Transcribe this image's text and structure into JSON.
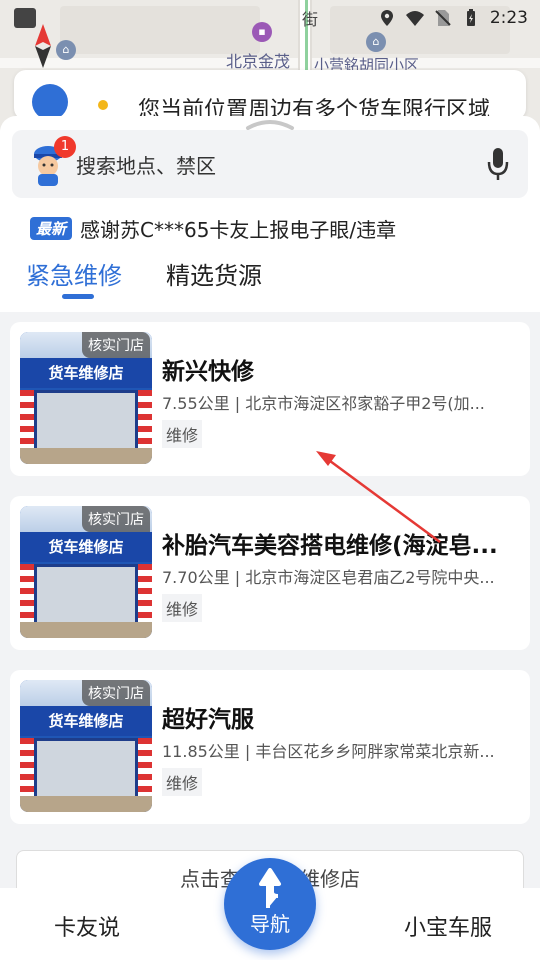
{
  "status_bar": {
    "time": "2:23"
  },
  "map": {
    "labels": {
      "beijing_jinmao": "北京金茂",
      "street": "街",
      "community": "小营銘胡同小区"
    }
  },
  "notice": {
    "text": "您当前位置周边有多个货车限行区域"
  },
  "search": {
    "placeholder": "搜索地点、禁区",
    "badge_count": "1"
  },
  "news": {
    "tag": "最新",
    "text": "感谢苏C***65卡友上报电子眼/违章"
  },
  "tabs": [
    {
      "label": "紧急维修",
      "active": true
    },
    {
      "label": "精选货源",
      "active": false
    }
  ],
  "shops": [
    {
      "verified": "核实门店",
      "image_sign": "货车维修店",
      "name": "新兴快修",
      "info": "7.55公里 | 北京市海淀区祁家豁子甲2号(加...",
      "tag": "维修"
    },
    {
      "verified": "核实门店",
      "image_sign": "货车维修店",
      "name": "补胎汽车美容搭电维修(海淀皂...",
      "info": "7.70公里 | 北京市海淀区皂君庙乙2号院中央...",
      "tag": "维修"
    },
    {
      "verified": "核实门店",
      "image_sign": "货车维修店",
      "name": "超好汽服",
      "info": "11.85公里 | 丰台区花乡乡阿胖家常菜北京新...",
      "tag": "维修"
    }
  ],
  "more_button": "点击查看更多维修店",
  "bottom_nav": {
    "left": "卡友说",
    "center": "导航",
    "right": "小宝车服"
  },
  "colors": {
    "accent": "#2f6fd6",
    "badge": "#f0392c",
    "annotation": "#e53935"
  }
}
